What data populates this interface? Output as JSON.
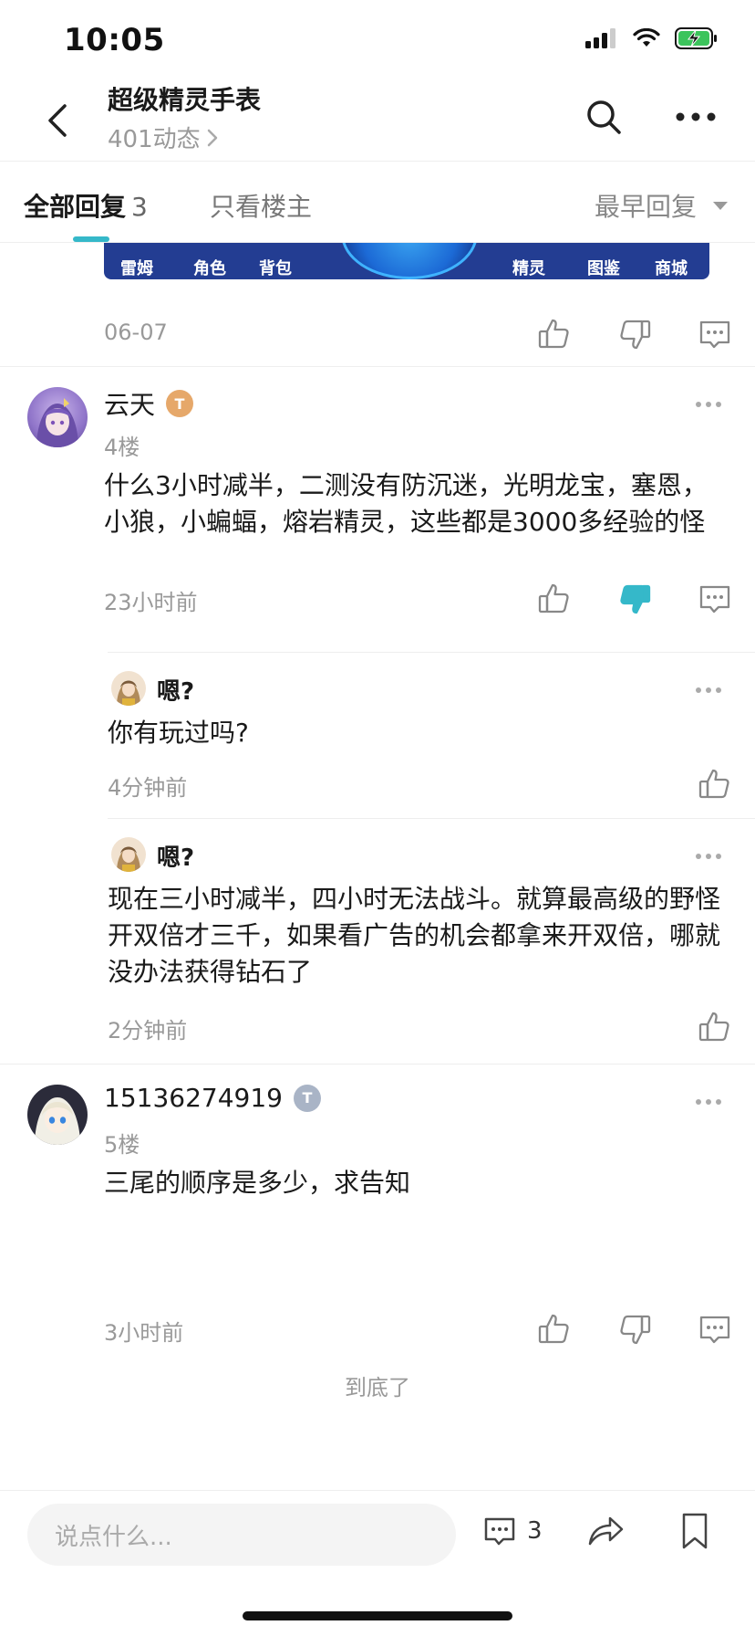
{
  "status_bar": {
    "time": "10:05"
  },
  "nav": {
    "title": "超级精灵手表",
    "subtitle": "401动态"
  },
  "tabs": {
    "all_label": "全部回复",
    "all_count": "3",
    "op_only": "只看楼主",
    "sort": "最早回复"
  },
  "banner": {
    "labels": [
      "雷姆",
      "角色",
      "背包",
      "精灵",
      "图鉴",
      "商城"
    ]
  },
  "top_post": {
    "date": "06-07"
  },
  "floors": [
    {
      "name": "云天",
      "badge": "T",
      "floor": "4楼",
      "text": "什么3小时减半，二测没有防沉迷，光明龙宝，塞恩，小狼，小蝙蝠，熔岩精灵，这些都是3000多经验的怪",
      "time": "23小时前",
      "replies": [
        {
          "name": "嗯?",
          "text": "你有玩过吗?",
          "time": "4分钟前"
        },
        {
          "name": "嗯?",
          "text": "现在三小时减半，四小时无法战斗。就算最高级的野怪开双倍才三千，如果看广告的机会都拿来开双倍，哪就没办法获得钻石了",
          "time": "2分钟前"
        }
      ]
    },
    {
      "name": "15136274919",
      "badge": "T",
      "floor": "5楼",
      "text": "三尾的顺序是多少，求告知",
      "time": "3小时前"
    }
  ],
  "end_text": "到底了",
  "bottom_bar": {
    "placeholder": "说点什么...",
    "comment_count": "3"
  },
  "colors": {
    "accent": "#35b8c9",
    "badge_gold": "#e6a86a",
    "badge_silver": "#a9b4c6"
  }
}
